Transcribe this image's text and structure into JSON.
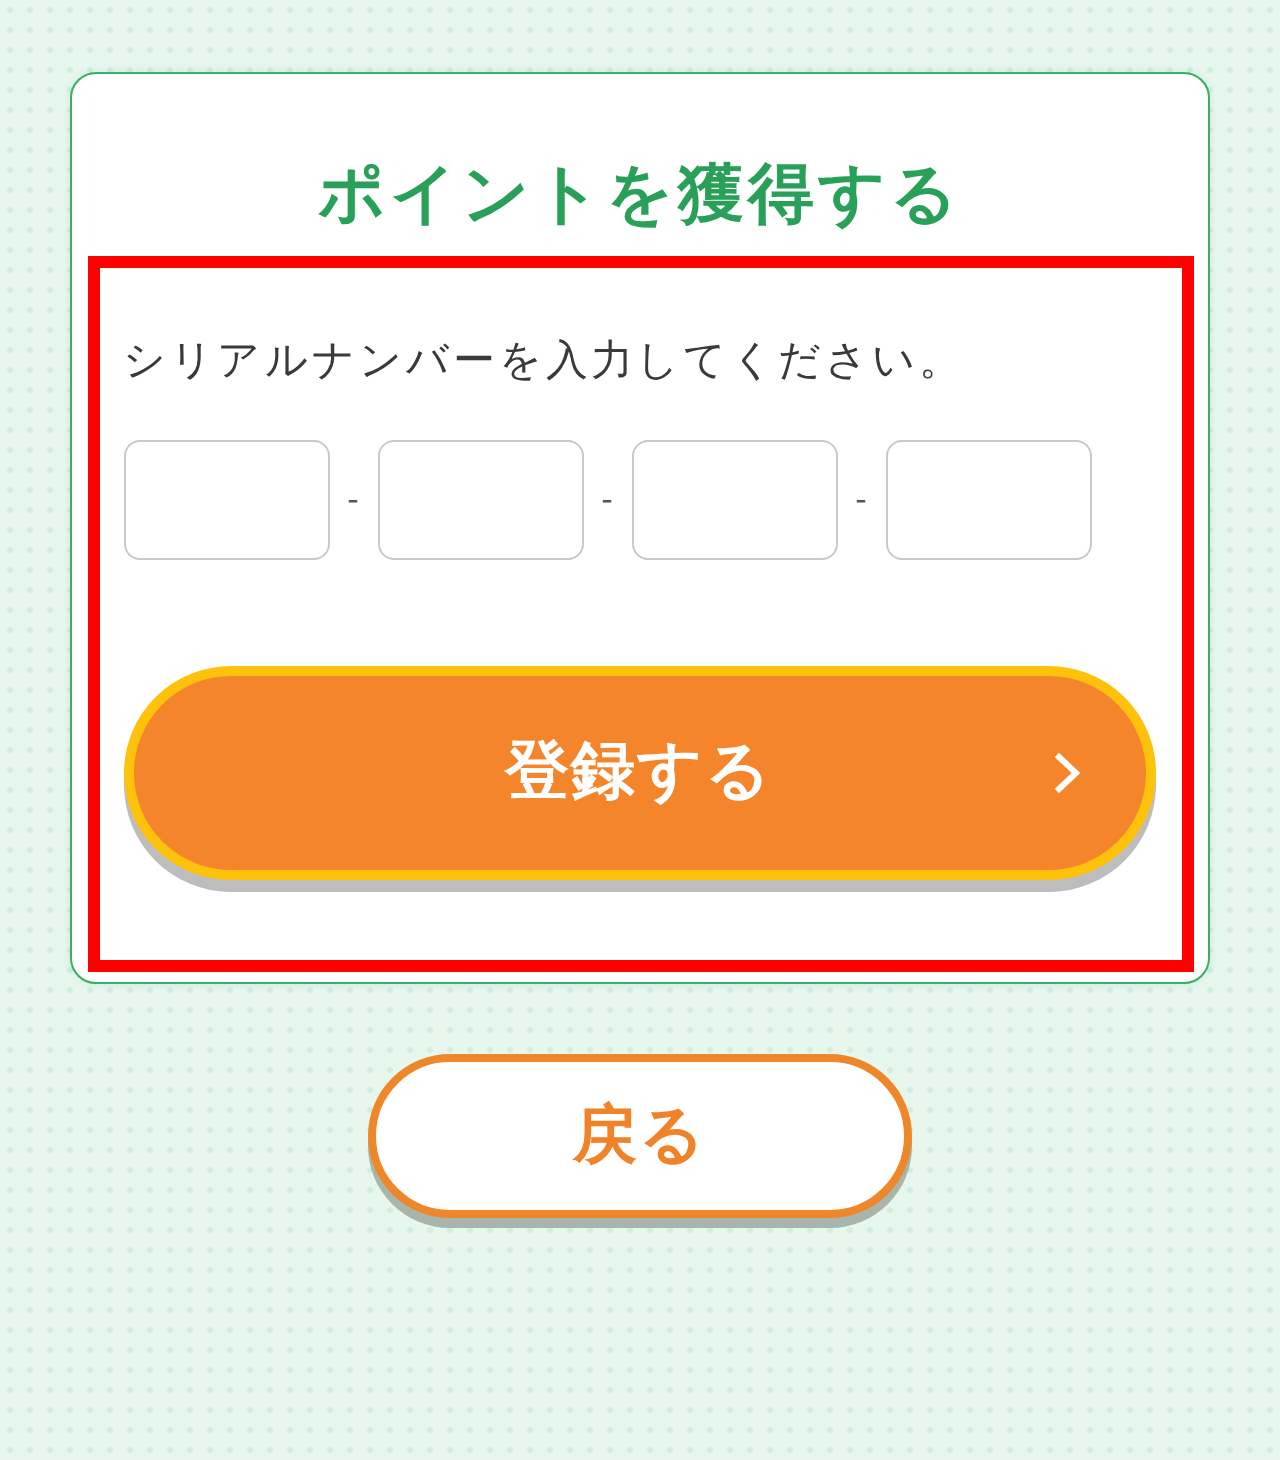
{
  "title": "ポイントを獲得する",
  "form": {
    "highlighted": true,
    "instruction": "シリアルナンバーを入力してください。",
    "serial_input": [
      {
        "kind": "field"
      },
      {
        "kind": "separator",
        "text": "-"
      },
      {
        "kind": "field"
      },
      {
        "kind": "separator",
        "text": "-"
      },
      {
        "kind": "field"
      },
      {
        "kind": "separator",
        "text": "-"
      },
      {
        "kind": "field"
      }
    ],
    "submit_button": {
      "label": "登録する"
    }
  },
  "back_button": {
    "label": "戻る"
  }
}
